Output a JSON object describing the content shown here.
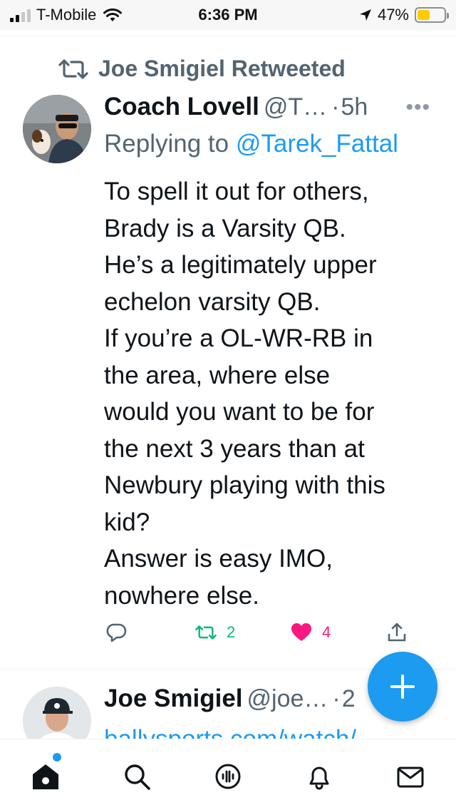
{
  "status_bar": {
    "carrier": "T-Mobile",
    "time": "6:36 PM",
    "battery_percent": "47%",
    "battery_level": 0.47,
    "icons": [
      "signal-icon",
      "wifi-icon",
      "location-arrow-icon",
      "battery-icon"
    ]
  },
  "retweet_header": {
    "label": "Joe Smigiel Retweeted",
    "icon": "retweet-icon"
  },
  "tweet": {
    "author_name": "Coach Lovell",
    "author_handle": "@T…",
    "separator": "·",
    "time": "5h",
    "more_icon": "more-dots-icon",
    "reply_prefix": "Replying to",
    "reply_to": "@Tarek_Fattal",
    "lines": [
      "To spell it out for others,",
      "Brady is a Varsity QB.",
      "He’s a legitimately upper",
      "echelon varsity QB.",
      "If you’re a OL-WR-RB in",
      "the area, where else",
      "would you want to be for",
      "the next 3 years than at",
      "Newbury playing with this",
      "kid?",
      "Answer is easy IMO,",
      "nowhere else."
    ],
    "actions": {
      "reply_count": "",
      "retweet_count": "2",
      "like_count": "4",
      "colors": {
        "retweet": "#00ba7c",
        "like": "#f91880"
      }
    }
  },
  "next_tweet": {
    "author_name": "Joe Smigiel",
    "author_handle": "@joe…",
    "separator": "·",
    "time": "2",
    "link_text": "ballysports.com/watch/"
  },
  "compose_button": {
    "icon": "plus-icon",
    "color": "#1d9bf0"
  },
  "bottom_nav": {
    "items": [
      {
        "name": "home",
        "icon": "home-icon",
        "active": true
      },
      {
        "name": "search",
        "icon": "search-icon"
      },
      {
        "name": "spaces",
        "icon": "spaces-icon"
      },
      {
        "name": "notifications",
        "icon": "bell-icon"
      },
      {
        "name": "messages",
        "icon": "envelope-icon"
      }
    ]
  }
}
